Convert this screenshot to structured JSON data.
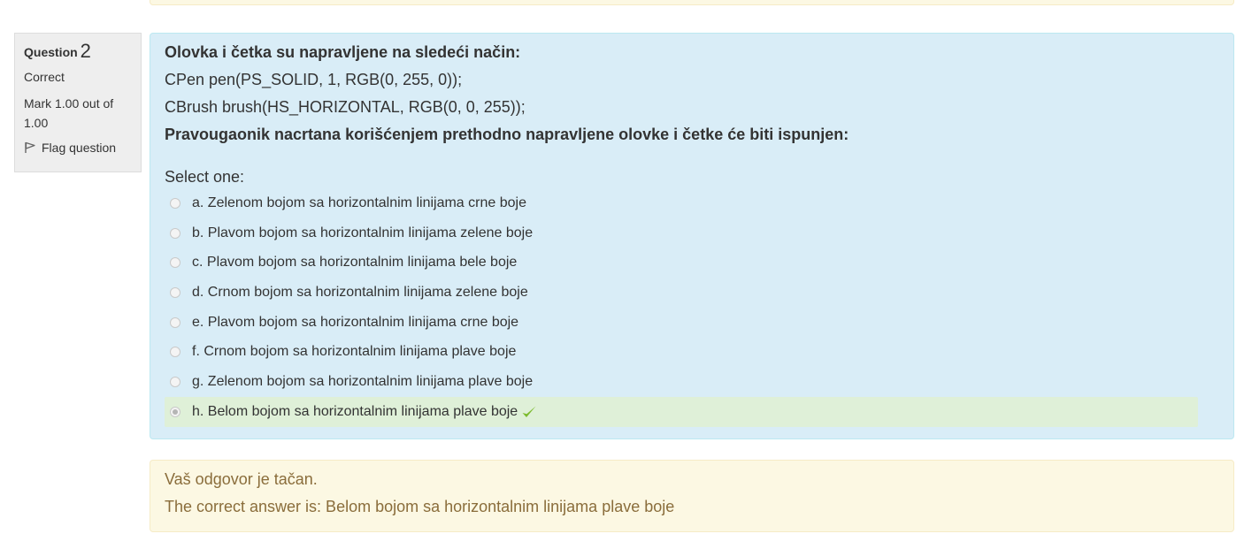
{
  "question": {
    "label": "Question",
    "number": "2",
    "state": "Correct",
    "grade": "Mark 1.00 out of 1.00",
    "flag_label": "Flag question",
    "text_lines": [
      "Olovka i četka su napravljene na sledeći način:",
      "CPen pen(PS_SOLID, 1, RGB(0, 255, 0));",
      "CBrush brush(HS_HORIZONTAL, RGB(0, 0, 255));",
      "Pravougaonik nacrtana korišćenjem prethodno napravljene olovke i četke će biti ispunjen:"
    ],
    "prompt": "Select one:",
    "options": [
      {
        "label": "a. Zelenom bojom sa horizontalnim linijama crne boje",
        "selected": false,
        "correct": false
      },
      {
        "label": "b. Plavom bojom sa horizontalnim linijama zelene boje",
        "selected": false,
        "correct": false
      },
      {
        "label": "c. Plavom bojom sa horizontalnim linijama bele boje",
        "selected": false,
        "correct": false
      },
      {
        "label": "d. Crnom bojom sa horizontalnim linijama zelene boje",
        "selected": false,
        "correct": false
      },
      {
        "label": "e. Plavom bojom sa horizontalnim linijama crne boje",
        "selected": false,
        "correct": false
      },
      {
        "label": "f. Crnom bojom sa horizontalnim linijama plave boje",
        "selected": false,
        "correct": false
      },
      {
        "label": "g. Zelenom bojom sa horizontalnim linijama plave boje",
        "selected": false,
        "correct": false
      },
      {
        "label": "h. Belom bojom sa horizontalnim linijama plave boje",
        "selected": true,
        "correct": true
      }
    ]
  },
  "feedback": {
    "specific": "Vaš odgovor je tačan.",
    "right_answer": "The correct answer is: Belom bojom sa horizontalnim linijama plave boje"
  },
  "colors": {
    "formulation_bg": "#d9edf7",
    "correct_bg": "#dff0d8",
    "outcome_bg": "#fcf8e3",
    "tick": "#7cbb2e"
  },
  "icons": {
    "flag": "flag-icon",
    "tick": "checkmark-icon"
  }
}
